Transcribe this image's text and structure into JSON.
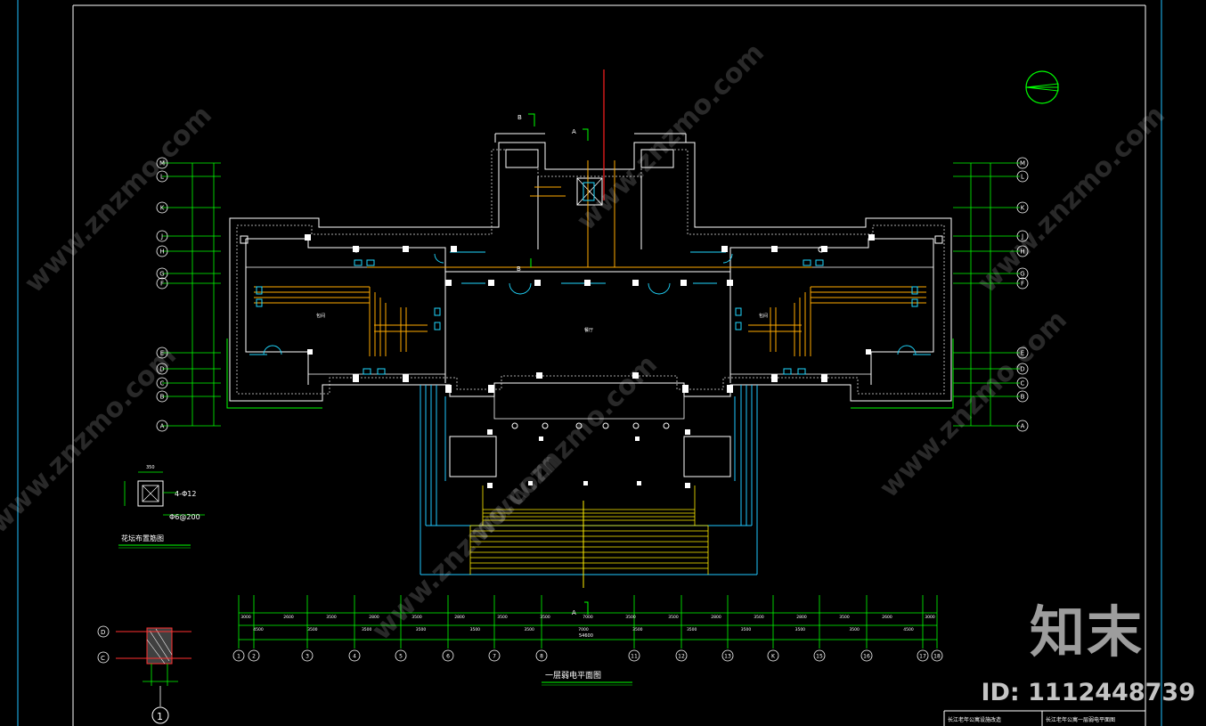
{
  "drawing": {
    "title": "一层弱电平面图",
    "detail_title": "花坛布置筋图",
    "detail_note_1": "4-Φ12",
    "detail_note_2": "Φ6@200",
    "detail_dim": "350",
    "section_marker": "1",
    "center_room": "餐厅",
    "side_room": "包间",
    "total_dim": "54600",
    "title_block_left": "长江老年公寓设施改造",
    "title_block_right": "长江老年公寓一层弱电平面图",
    "axis_rows_left": [
      "M",
      "L",
      "K",
      "J",
      "H",
      "G",
      "F",
      "E",
      "D",
      "C",
      "B",
      "A"
    ],
    "axis_cols_bottom": [
      "1",
      "2",
      "3",
      "4",
      "5",
      "6",
      "7",
      "8",
      "11",
      "12",
      "13",
      "K",
      "15",
      "16",
      "17",
      "18"
    ],
    "dims_bottom_top": [
      "3000",
      "2600",
      "3500",
      "2800",
      "3500",
      "2800",
      "3500",
      "3500",
      "7000",
      "3500",
      "3500",
      "2800",
      "3500",
      "2800",
      "3500",
      "2600",
      "3000"
    ],
    "dims_bottom_mid": [
      "4500",
      "3500",
      "3500",
      "3500",
      "3500",
      "3500",
      "7000",
      "3500",
      "3500",
      "3500",
      "3500",
      "3500",
      "4500"
    ],
    "cut_markers": [
      "B",
      "A",
      "B",
      "A"
    ]
  },
  "watermark": {
    "site": "www.znzmo.com",
    "logo": "知末",
    "id": "ID: 1112448739"
  }
}
